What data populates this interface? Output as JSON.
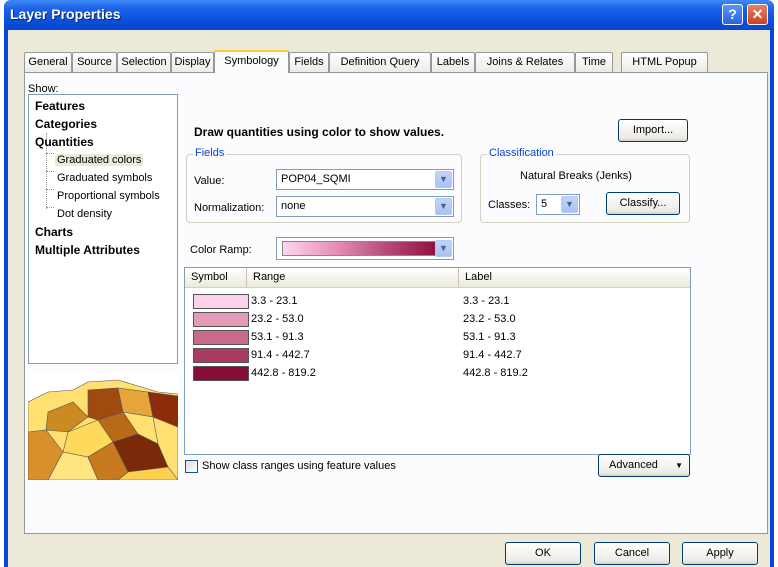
{
  "window": {
    "title": "Layer Properties",
    "help_glyph": "?",
    "close_glyph": "✕"
  },
  "tabs": [
    {
      "label": "General"
    },
    {
      "label": "Source"
    },
    {
      "label": "Selection"
    },
    {
      "label": "Display"
    },
    {
      "label": "Symbology"
    },
    {
      "label": "Fields"
    },
    {
      "label": "Definition Query"
    },
    {
      "label": "Labels"
    },
    {
      "label": "Joins & Relates"
    },
    {
      "label": "Time"
    },
    {
      "label": "HTML Popup"
    }
  ],
  "active_tab": "Symbology",
  "show": {
    "label": "Show:",
    "items": [
      {
        "label": "Features",
        "level": 0
      },
      {
        "label": "Categories",
        "level": 0
      },
      {
        "label": "Quantities",
        "level": 0
      },
      {
        "label": "Graduated colors",
        "level": 1,
        "selected": true
      },
      {
        "label": "Graduated symbols",
        "level": 1
      },
      {
        "label": "Proportional symbols",
        "level": 1
      },
      {
        "label": "Dot density",
        "level": 1
      },
      {
        "label": "Charts",
        "level": 0
      },
      {
        "label": "Multiple Attributes",
        "level": 0
      }
    ]
  },
  "headline": "Draw quantities using color to show values.",
  "import_button": "Import...",
  "fields": {
    "group_title": "Fields",
    "value_label": "Value:",
    "value": "POP04_SQMI",
    "normalization_label": "Normalization:",
    "normalization": "none"
  },
  "classification": {
    "group_title": "Classification",
    "method": "Natural Breaks (Jenks)",
    "classes_label": "Classes:",
    "classes_value": "5",
    "classify_button": "Classify..."
  },
  "color_ramp": {
    "label": "Color Ramp:",
    "colors": [
      "#fcd8ec",
      "#e78fb8",
      "#b54a7a",
      "#8a0f3a"
    ]
  },
  "table": {
    "headers": {
      "symbol": "Symbol",
      "range": "Range",
      "label": "Label"
    },
    "rows": [
      {
        "range": "3.3 - 23.1",
        "label": "3.3 - 23.1",
        "color": "#fdd0ec"
      },
      {
        "range": "23.2 - 53.0",
        "label": "23.2 - 53.0",
        "color": "#e59ab7"
      },
      {
        "range": "53.1 - 91.3",
        "label": "53.1 - 91.3",
        "color": "#c86b88"
      },
      {
        "range": "91.4 - 442.7",
        "label": "91.4 - 442.7",
        "color": "#ab3a5f"
      },
      {
        "range": "442.8 - 819.2",
        "label": "442.8 - 819.2",
        "color": "#870d38"
      }
    ]
  },
  "show_class_ranges_label": "Show class ranges using feature values",
  "advanced_button": "Advanced",
  "footer": {
    "ok": "OK",
    "cancel": "Cancel",
    "apply": "Apply"
  }
}
